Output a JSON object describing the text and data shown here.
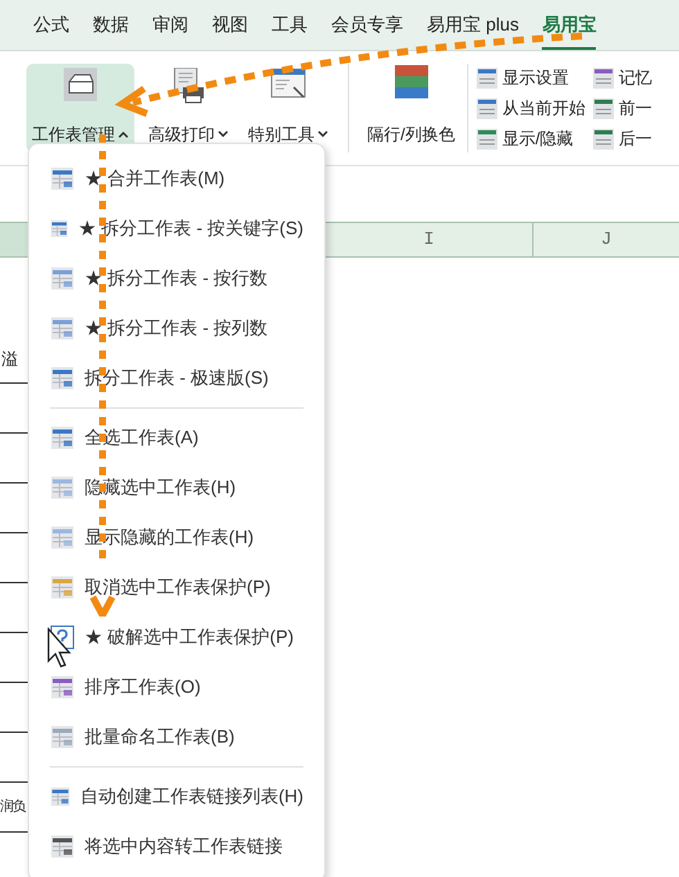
{
  "tabs": [
    {
      "label": "公式",
      "selected": false
    },
    {
      "label": "数据",
      "selected": false
    },
    {
      "label": "审阅",
      "selected": false
    },
    {
      "label": "视图",
      "selected": false
    },
    {
      "label": "工具",
      "selected": false
    },
    {
      "label": "会员专享",
      "selected": false
    },
    {
      "label": "易用宝 plus",
      "selected": false
    },
    {
      "label": "易用宝",
      "selected": true
    }
  ],
  "ribbon": {
    "big_buttons": [
      {
        "label": "工作表管理",
        "expanded": true
      },
      {
        "label": "高级打印",
        "expanded": false
      },
      {
        "label": "特别工具",
        "expanded": false
      }
    ],
    "color_button": {
      "label": "隔行/列换色"
    },
    "small_buttons": [
      {
        "label": "显示设置"
      },
      {
        "label": "从当前开始"
      },
      {
        "label": "显示/隐藏"
      },
      {
        "label": "记忆"
      },
      {
        "label": "前一"
      },
      {
        "label": "后一"
      }
    ]
  },
  "sheet": {
    "columns": [
      "I",
      "J"
    ],
    "cells": [
      "溢",
      "润负"
    ]
  },
  "menu": {
    "sections": [
      {
        "items": [
          {
            "label": "★ 合并工作表(M)"
          },
          {
            "label": "★ 拆分工作表 - 按关键字(S)"
          },
          {
            "label": "★ 拆分工作表 - 按行数"
          },
          {
            "label": "★ 拆分工作表 - 按列数"
          },
          {
            "label": "拆分工作表 - 极速版(S)"
          }
        ]
      },
      {
        "items": [
          {
            "label": "全选工作表(A)"
          },
          {
            "label": "隐藏选中工作表(H)"
          },
          {
            "label": "显示隐藏的工作表(H)"
          },
          {
            "label": "取消选中工作表保护(P)"
          },
          {
            "label": "★ 破解选中工作表保护(P)"
          },
          {
            "label": "排序工作表(O)"
          },
          {
            "label": "批量命名工作表(B)"
          }
        ]
      },
      {
        "items": [
          {
            "label": "自动创建工作表链接列表(H)"
          },
          {
            "label": "将选中内容转工作表链接"
          }
        ]
      }
    ]
  }
}
